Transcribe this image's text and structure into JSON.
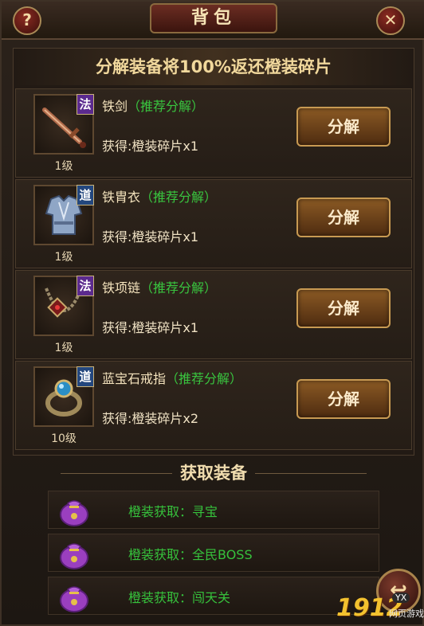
{
  "window": {
    "title": "背包",
    "help_label": "?",
    "close_label": "✕"
  },
  "banner_text": "分解装备将100%返还橙装碎片",
  "items": [
    {
      "name": "铁剑",
      "tag": "（推荐分解）",
      "badge": "法",
      "level": "1级",
      "gain": "获得:橙装碎片x1",
      "button": "分解"
    },
    {
      "name": "铁胄衣",
      "tag": "（推荐分解）",
      "badge": "道",
      "level": "1级",
      "gain": "获得:橙装碎片x1",
      "button": "分解"
    },
    {
      "name": "铁项链",
      "tag": "（推荐分解）",
      "badge": "法",
      "level": "1级",
      "gain": "获得:橙装碎片x1",
      "button": "分解"
    },
    {
      "name": "蓝宝石戒指",
      "tag": "（推荐分解）",
      "badge": "道",
      "level": "10级",
      "gain": "获得:橙装碎片x2",
      "button": "分解"
    }
  ],
  "acquire": {
    "title": "获取装备",
    "rows": [
      {
        "text": "橙装获取：寻宝"
      },
      {
        "text": "橙装获取：全民BOSS"
      },
      {
        "text": "橙装获取：闯天关"
      }
    ]
  },
  "watermark": {
    "number": "1912",
    "badge": "YX",
    "sub": "网页游戏"
  }
}
